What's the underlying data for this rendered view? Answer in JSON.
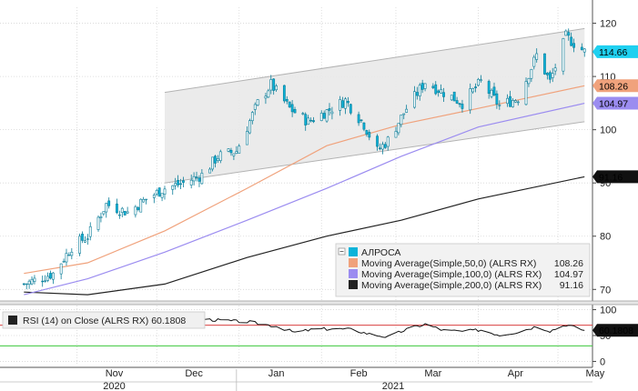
{
  "chart_data": [
    {
      "type": "candlestick",
      "instrument": "АЛРОСА",
      "y_ticks": [
        70,
        80,
        90,
        100,
        110,
        120
      ],
      "ylim": [
        68,
        123
      ],
      "x_month_labels": [
        "Nov",
        "Dec",
        "Jan",
        "Feb",
        "Mar",
        "Apr",
        "May"
      ],
      "x_year_labels": [
        "2020",
        "2021"
      ],
      "start_date": "2020-10-12",
      "end_date": "2021-05-11",
      "series": [
        {
          "name": "АЛРОСА",
          "color": "#0bb3d9",
          "last": "114.66"
        },
        {
          "name": "Moving Average(Simple,50,0) (ALRS RX)",
          "color": "#f0a27c",
          "last": "108.26"
        },
        {
          "name": "Moving Average(Simple,100,0) (ALRS RX)",
          "color": "#9b8cf0",
          "last": "104.97"
        },
        {
          "name": "Moving Average(Simple,200,0) (ALRS RX)",
          "color": "#222222",
          "last": "91.16"
        }
      ],
      "close_points": [
        {
          "date": "2020-10-12",
          "value": 71.0
        },
        {
          "date": "2020-10-23",
          "value": 73.0
        },
        {
          "date": "2020-10-30",
          "value": 78.0
        },
        {
          "date": "2020-11-05",
          "value": 80.0
        },
        {
          "date": "2020-11-12",
          "value": 86.0
        },
        {
          "date": "2020-11-20",
          "value": 84.5
        },
        {
          "date": "2020-11-27",
          "value": 87.0
        },
        {
          "date": "2020-12-04",
          "value": 89.0
        },
        {
          "date": "2020-12-11",
          "value": 90.0
        },
        {
          "date": "2020-12-18",
          "value": 91.5
        },
        {
          "date": "2020-12-24",
          "value": 95.0
        },
        {
          "date": "2020-12-31",
          "value": 96.0
        },
        {
          "date": "2021-01-08",
          "value": 105.0
        },
        {
          "date": "2021-01-13",
          "value": 108.5
        },
        {
          "date": "2021-01-20",
          "value": 104.0
        },
        {
          "date": "2021-01-27",
          "value": 101.5
        },
        {
          "date": "2021-02-03",
          "value": 103.5
        },
        {
          "date": "2021-02-10",
          "value": 105.5
        },
        {
          "date": "2021-02-17",
          "value": 101.0
        },
        {
          "date": "2021-02-22",
          "value": 96.0
        },
        {
          "date": "2021-02-26",
          "value": 98.0
        },
        {
          "date": "2021-03-05",
          "value": 104.0
        },
        {
          "date": "2021-03-12",
          "value": 109.0
        },
        {
          "date": "2021-03-19",
          "value": 107.0
        },
        {
          "date": "2021-03-26",
          "value": 105.0
        },
        {
          "date": "2021-04-02",
          "value": 109.0
        },
        {
          "date": "2021-04-09",
          "value": 104.5
        },
        {
          "date": "2021-04-16",
          "value": 106.0
        },
        {
          "date": "2021-04-23",
          "value": 114.0
        },
        {
          "date": "2021-04-28",
          "value": 109.0
        },
        {
          "date": "2021-05-04",
          "value": 117.5
        },
        {
          "date": "2021-05-11",
          "value": 114.66
        }
      ],
      "ma50_points": [
        {
          "date": "2020-10-12",
          "value": 73.0
        },
        {
          "date": "2020-11-05",
          "value": 75.0
        },
        {
          "date": "2020-12-04",
          "value": 81.0
        },
        {
          "date": "2021-01-04",
          "value": 89.0
        },
        {
          "date": "2021-02-03",
          "value": 97.0
        },
        {
          "date": "2021-03-03",
          "value": 101.0
        },
        {
          "date": "2021-04-01",
          "value": 104.0
        },
        {
          "date": "2021-05-11",
          "value": 108.26
        }
      ],
      "ma100_points": [
        {
          "date": "2020-10-12",
          "value": 69.0
        },
        {
          "date": "2020-11-05",
          "value": 72.0
        },
        {
          "date": "2020-12-04",
          "value": 77.0
        },
        {
          "date": "2021-01-04",
          "value": 83.0
        },
        {
          "date": "2021-02-03",
          "value": 89.0
        },
        {
          "date": "2021-03-03",
          "value": 95.0
        },
        {
          "date": "2021-04-01",
          "value": 100.5
        },
        {
          "date": "2021-05-11",
          "value": 104.97
        }
      ],
      "ma200_points": [
        {
          "date": "2020-10-12",
          "value": 69.5
        },
        {
          "date": "2020-11-05",
          "value": 69.0
        },
        {
          "date": "2020-12-04",
          "value": 71.0
        },
        {
          "date": "2021-01-04",
          "value": 76.0
        },
        {
          "date": "2021-02-03",
          "value": 80.0
        },
        {
          "date": "2021-03-03",
          "value": 83.0
        },
        {
          "date": "2021-04-01",
          "value": 87.0
        },
        {
          "date": "2021-05-11",
          "value": 91.16
        }
      ],
      "channel": {
        "upper_start": {
          "date": "2020-12-04",
          "value": 107.0
        },
        "upper_end": {
          "date": "2021-05-11",
          "value": 119.0
        },
        "lower_start": {
          "date": "2020-12-04",
          "value": 90.0
        },
        "lower_end": {
          "date": "2021-05-11",
          "value": 101.5
        }
      },
      "last_tags": [
        "114.66",
        "108.26",
        "104.97",
        "91.16"
      ]
    },
    {
      "type": "line",
      "name": "RSI (14)  on Close (ALRS RX)",
      "last": "60.1808",
      "y_ticks": [
        0,
        50,
        100
      ],
      "ylim": [
        -8,
        108
      ],
      "overbought": 70,
      "oversold": 30,
      "points": [
        {
          "date": "2020-10-12",
          "value": 85
        },
        {
          "date": "2020-12-04",
          "value": 86
        },
        {
          "date": "2021-01-05",
          "value": 76
        },
        {
          "date": "2021-01-15",
          "value": 68
        },
        {
          "date": "2021-01-22",
          "value": 56
        },
        {
          "date": "2021-01-29",
          "value": 62
        },
        {
          "date": "2021-02-05",
          "value": 63
        },
        {
          "date": "2021-02-12",
          "value": 62
        },
        {
          "date": "2021-02-19",
          "value": 53
        },
        {
          "date": "2021-02-26",
          "value": 47
        },
        {
          "date": "2021-03-05",
          "value": 62
        },
        {
          "date": "2021-03-12",
          "value": 72
        },
        {
          "date": "2021-03-19",
          "value": 60
        },
        {
          "date": "2021-03-26",
          "value": 58
        },
        {
          "date": "2021-04-02",
          "value": 61
        },
        {
          "date": "2021-04-09",
          "value": 51
        },
        {
          "date": "2021-04-16",
          "value": 57
        },
        {
          "date": "2021-04-23",
          "value": 68
        },
        {
          "date": "2021-04-28",
          "value": 59
        },
        {
          "date": "2021-05-04",
          "value": 71
        },
        {
          "date": "2021-05-11",
          "value": 60.18
        }
      ]
    }
  ]
}
